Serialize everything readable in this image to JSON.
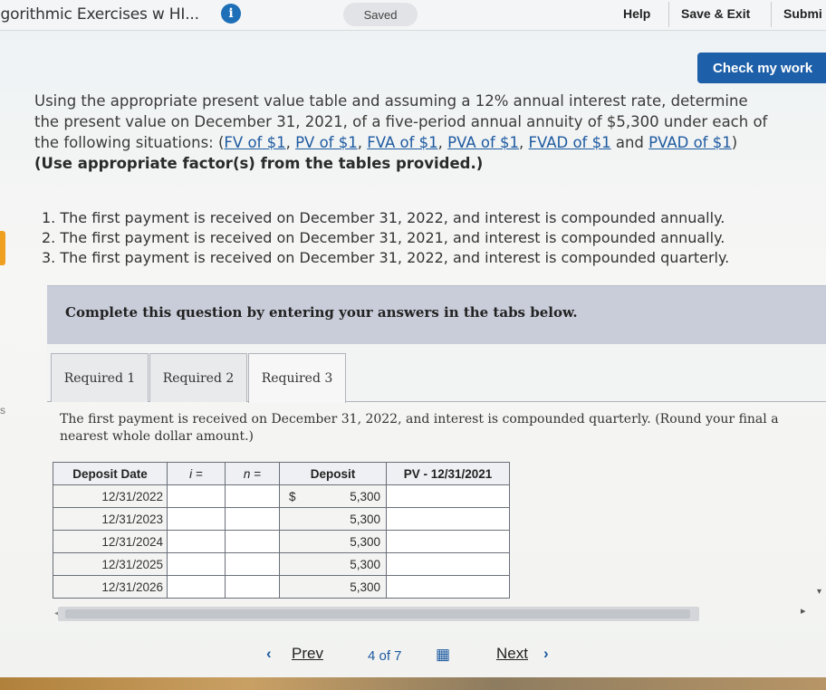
{
  "header": {
    "app_title": "lgorithmic Exercises w HI...",
    "info_icon": "i",
    "saved_label": "Saved",
    "help_label": "Help",
    "save_exit_label": "Save & Exit",
    "submit_label": "Submi"
  },
  "check_button": "Check my work",
  "question": {
    "intro": "Using the appropriate present value table and assuming a 12% annual interest rate, determine the present value on December 31, 2021, of a five-period annual annuity of $5,300 under each of the following situations: (",
    "links": [
      "FV of $1",
      "PV of $1",
      "FVA of $1",
      "PVA of $1",
      "FVAD of $1",
      "PVAD of $1"
    ],
    "sep_comma": ", ",
    "sep_and": " and ",
    "close_paren": ") ",
    "bold_tail": "(Use appropriate factor(s) from the tables provided.)"
  },
  "requirements": [
    "1. The first payment is received on December 31, 2022, and interest is compounded annually.",
    "2. The first payment is received on December 31, 2021, and interest is compounded annually.",
    "3. The first payment is received on December 31, 2022, and interest is compounded quarterly."
  ],
  "complete_prompt": "Complete this question by entering your answers in the tabs below.",
  "tabs": [
    {
      "label": "Required 1"
    },
    {
      "label": "Required 2"
    },
    {
      "label": "Required 3"
    }
  ],
  "side_mark": "s",
  "instruction": "The first payment is received on December 31, 2022, and interest is compounded quarterly. (Round your final a",
  "instruction_line2": "nearest whole dollar amount.)",
  "table": {
    "headers": [
      "Deposit Date",
      "i =",
      "n =",
      "Deposit",
      "PV - 12/31/2021"
    ],
    "currency": "$",
    "rows": [
      {
        "date": "12/31/2022",
        "deposit": "5,300"
      },
      {
        "date": "12/31/2023",
        "deposit": "5,300"
      },
      {
        "date": "12/31/2024",
        "deposit": "5,300"
      },
      {
        "date": "12/31/2025",
        "deposit": "5,300"
      },
      {
        "date": "12/31/2026",
        "deposit": "5,300"
      }
    ]
  },
  "pager": {
    "prev_arrow": "‹",
    "prev_label": "Prev",
    "page_text": "4 of 7",
    "grid_icon": "▦",
    "next_label": "Next",
    "next_arrow": "›"
  }
}
